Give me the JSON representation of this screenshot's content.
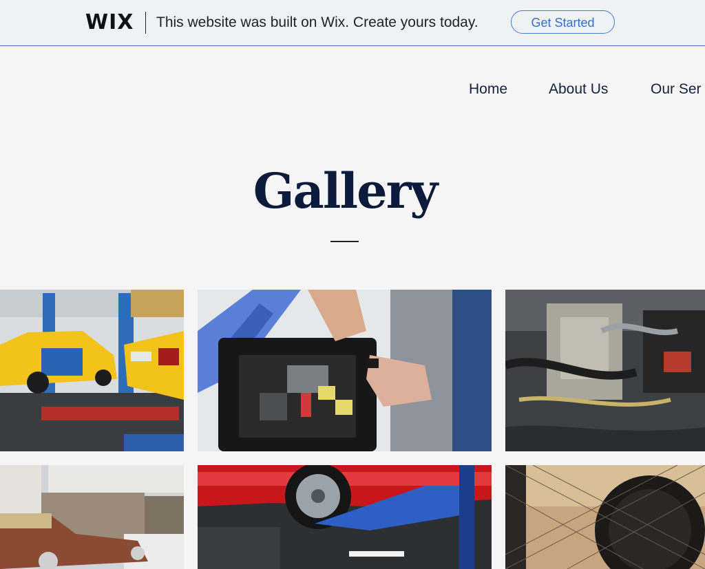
{
  "wix_banner": {
    "logo": "WIX",
    "message": "This website was built on Wix. Create yours today.",
    "cta_label": "Get Started"
  },
  "nav": {
    "items": [
      {
        "label": "Home"
      },
      {
        "label": "About Us"
      },
      {
        "label": "Our Ser"
      }
    ]
  },
  "page": {
    "title": "Gallery"
  },
  "gallery": {
    "images": [
      {
        "subject": "yellow taxis in garage"
      },
      {
        "subject": "mechanic working on car fuse box"
      },
      {
        "subject": "car engine closeup"
      },
      {
        "subject": "old rusty classic car"
      },
      {
        "subject": "red car on lift"
      },
      {
        "subject": "tire behind chain-link fence"
      }
    ]
  },
  "colors": {
    "accent_blue": "#3b7bd6",
    "title_navy": "#0c1b3c",
    "background": "#f5f5f5"
  }
}
